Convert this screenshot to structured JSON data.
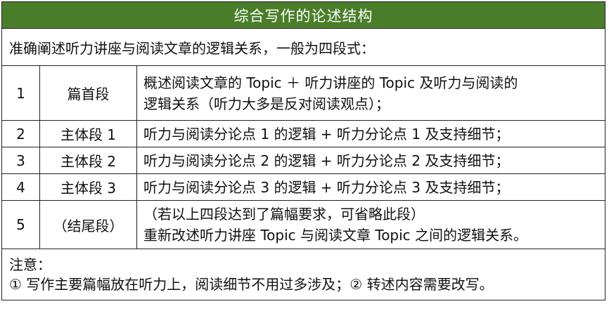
{
  "title": "综合写作的论述结构",
  "intro": "准确阐述听力讲座与阅读文章的逻辑关系，一般为四段式：",
  "rows": [
    {
      "num": "1",
      "name": "篇首段",
      "desc_line1": "概述阅读文章的 Topic ＋ 听力讲座的 Topic 及听力与阅读的",
      "desc_line2": "逻辑关系（听力大多是反对阅读观点）；"
    },
    {
      "num": "2",
      "name": "主体段 1",
      "desc_line1": "听力与阅读分论点 1 的逻辑 + 听力分论点 1 及支持细节；"
    },
    {
      "num": "3",
      "name": "主体段 2",
      "desc_line1": "听力与阅读分论点 2 的逻辑 + 听力分论点 2 及支持细节；"
    },
    {
      "num": "4",
      "name": "主体段 3",
      "desc_line1": "听力与阅读分论点 3 的逻辑 + 听力分论点 3 及支持细节；"
    },
    {
      "num": "5",
      "name": "（结尾段）",
      "desc_line1": "（若以上四段达到了篇幅要求，可省略此段）",
      "desc_line2": "重新改述听力讲座 Topic 与阅读文章 Topic 之间的逻辑关系。"
    }
  ],
  "note": {
    "label": "注意：",
    "text": "① 写作主要篇幅放在听力上，阅读细节不用过多涉及；② 转述内容需要改写。"
  },
  "colors": {
    "header_bg": "#4a7d2a",
    "header_text": "#ffffff",
    "border": "#222222"
  }
}
